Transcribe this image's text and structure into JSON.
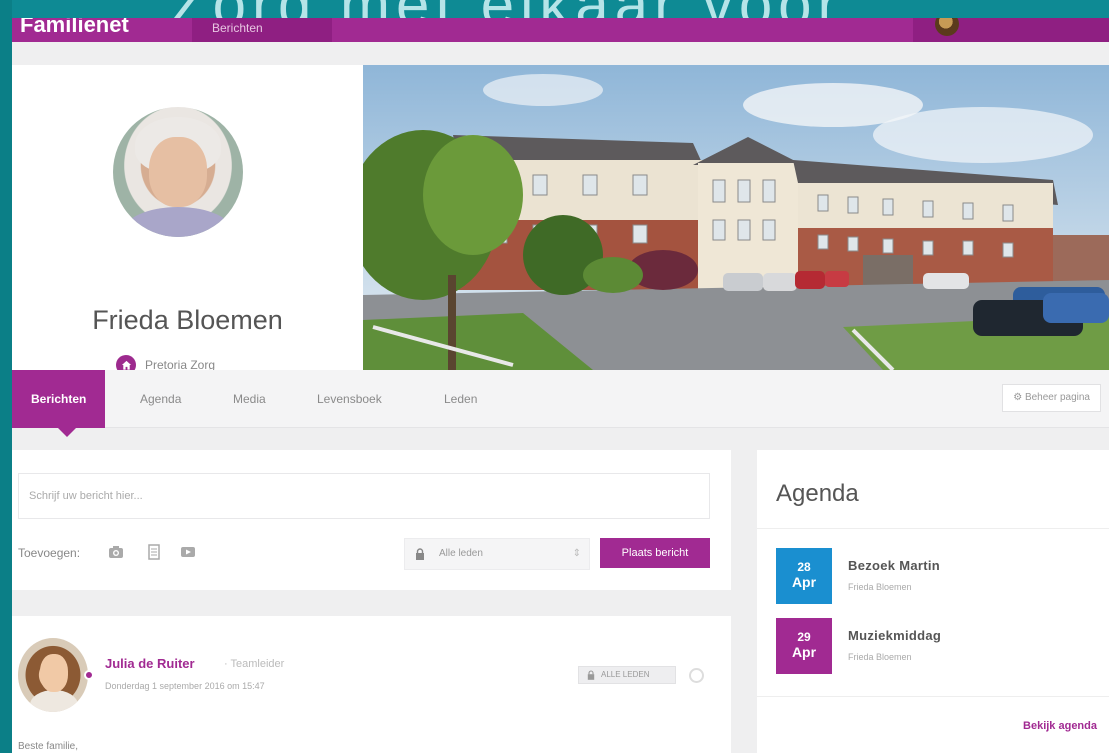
{
  "banner": {
    "text": "Zorg met elkaar voor"
  },
  "topnav": {
    "brand": "Familienet",
    "menu_item": "Berichten"
  },
  "profile": {
    "name": "Frieda Bloemen",
    "organization": "Pretoria Zorg"
  },
  "tabs": [
    {
      "label": "Berichten",
      "active": true
    },
    {
      "label": "Agenda"
    },
    {
      "label": "Media"
    },
    {
      "label": "Levensboek"
    },
    {
      "label": "Leden"
    }
  ],
  "manage_page_label": "Beheer pagina",
  "composer": {
    "placeholder": "Schrijf uw bericht hier...",
    "add_label": "Toevoegen:",
    "audience": "Alle leden",
    "post_button": "Plaats bericht"
  },
  "post": {
    "author": "Julia de Ruiter",
    "role": "Teamleider",
    "date": "Donderdag 1 september 2016 om 15:47",
    "visibility": "ALLE LEDEN",
    "text": "Beste familie,"
  },
  "agenda": {
    "title": "Agenda",
    "events": [
      {
        "day": "28",
        "month": "Apr",
        "title": "Bezoek Martin",
        "subtitle": "Frieda Bloemen",
        "color": "#1a8fd0"
      },
      {
        "day": "29",
        "month": "Apr",
        "title": "Muziekmiddag",
        "subtitle": "Frieda Bloemen",
        "color": "#a12a92"
      }
    ],
    "link": "Bekijk agenda"
  },
  "colors": {
    "accent": "#a12a92",
    "teal": "#0b7f87",
    "blue": "#1a8fd0"
  }
}
